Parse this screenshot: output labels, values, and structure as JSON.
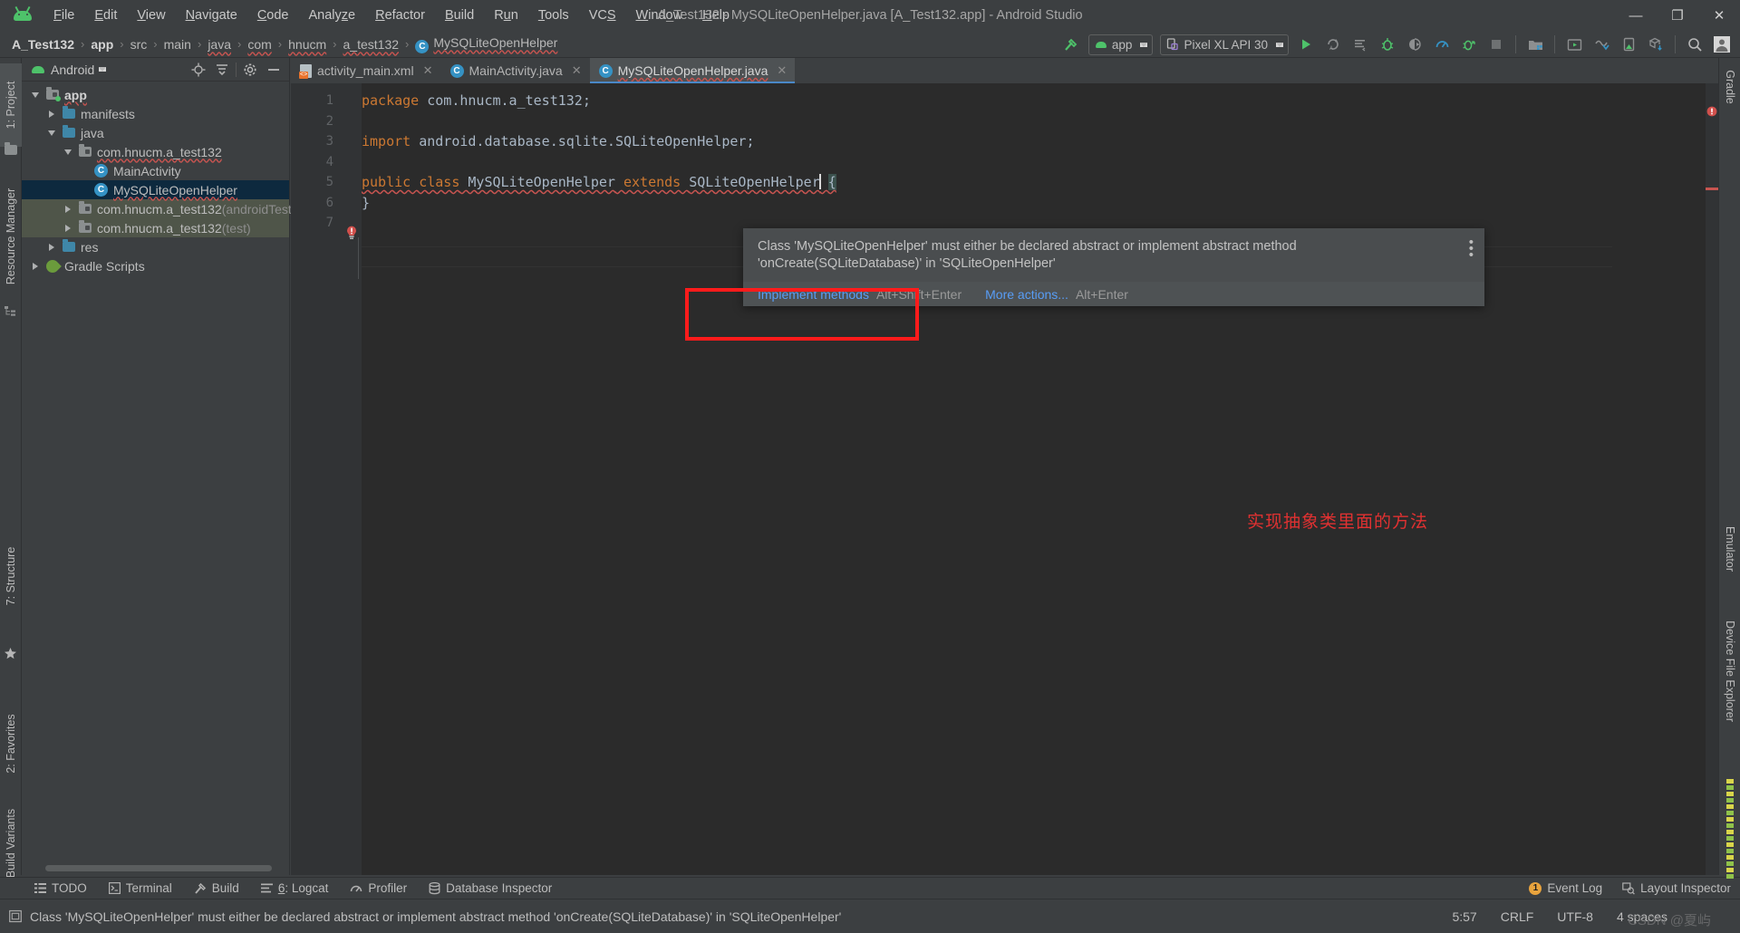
{
  "window": {
    "title": "A_Test132 - MySQLiteOpenHelper.java [A_Test132.app] - Android Studio",
    "minimize": "—",
    "maximize": "❐",
    "close": "✕"
  },
  "menubar": {
    "items": [
      {
        "label": "File",
        "mnemonic": "F"
      },
      {
        "label": "Edit",
        "mnemonic": "E"
      },
      {
        "label": "View",
        "mnemonic": "V"
      },
      {
        "label": "Navigate",
        "mnemonic": "N"
      },
      {
        "label": "Code",
        "mnemonic": "C"
      },
      {
        "label": "Analyze",
        "mnemonic": "z"
      },
      {
        "label": "Refactor",
        "mnemonic": "R"
      },
      {
        "label": "Build",
        "mnemonic": "B"
      },
      {
        "label": "Run",
        "mnemonic": "u"
      },
      {
        "label": "Tools",
        "mnemonic": "T"
      },
      {
        "label": "VCS",
        "mnemonic": "S"
      },
      {
        "label": "Window",
        "mnemonic": "W"
      },
      {
        "label": "Help",
        "mnemonic": "H"
      }
    ]
  },
  "breadcrumb": {
    "items": [
      {
        "label": "A_Test132",
        "bold": true
      },
      {
        "label": "app",
        "bold": true
      },
      {
        "label": "src",
        "bold": false
      },
      {
        "label": "main",
        "bold": false
      },
      {
        "label": "java",
        "bold": false
      },
      {
        "label": "com",
        "bold": false
      },
      {
        "label": "hnucm",
        "bold": false
      },
      {
        "label": "a_test132",
        "bold": false
      },
      {
        "label": "MySQLiteOpenHelper",
        "bold": false,
        "class_badge": "C"
      }
    ],
    "separator": "›"
  },
  "toolbar": {
    "module_selector": "app",
    "device_selector": "Pixel XL API 30",
    "icons": [
      "hammer-build-icon",
      "run-icon",
      "apply-changes-icon",
      "apply-code-changes-icon",
      "debug-icon",
      "attach-debugger-icon",
      "profiler-icon",
      "run-with-coverage-icon",
      "stop-icon",
      "sdk-manager-icon",
      "avd-manager-icon",
      "layout-inspector-icon",
      "device-file-explorer-icon",
      "build-variants-icon",
      "search-icon",
      "avatar-icon"
    ]
  },
  "left_tool_strip": {
    "tabs": [
      {
        "label": "1: Project",
        "selected": true
      },
      {
        "label": "Resource Manager",
        "selected": false
      },
      {
        "label": "7: Structure",
        "selected": false
      },
      {
        "label": "2: Favorites",
        "selected": false
      },
      {
        "label": "Build Variants",
        "selected": false
      }
    ]
  },
  "right_tool_strip": {
    "tabs": [
      {
        "label": "Gradle"
      },
      {
        "label": "Emulator"
      },
      {
        "label": "Device File Explorer"
      }
    ]
  },
  "project_panel": {
    "title": "Android",
    "header_icons": [
      "target-locate-icon",
      "collapse-all-icon",
      "settings-gear-icon",
      "hide-panel-icon"
    ],
    "tree": [
      {
        "indent": 0,
        "twisty": "down",
        "icon": "module-folder",
        "label": "app",
        "bold": true,
        "squiggle": true
      },
      {
        "indent": 1,
        "twisty": "right",
        "icon": "folder-blue",
        "label": "manifests",
        "bold": false
      },
      {
        "indent": 1,
        "twisty": "down",
        "icon": "folder-blue",
        "label": "java",
        "bold": false
      },
      {
        "indent": 2,
        "twisty": "down",
        "icon": "package",
        "label": "com.hnucm.a_test132",
        "bold": false,
        "squiggle": true
      },
      {
        "indent": 3,
        "twisty": "none",
        "icon": "class",
        "label": "MainActivity",
        "bold": false
      },
      {
        "indent": 3,
        "twisty": "none",
        "icon": "class",
        "label": "MySQLiteOpenHelper",
        "bold": false,
        "selected": true,
        "squiggle": true
      },
      {
        "indent": 2,
        "twisty": "right",
        "icon": "package",
        "label": "com.hnucm.a_test132",
        "suffix": " (androidTest)",
        "testbg": true
      },
      {
        "indent": 2,
        "twisty": "right",
        "icon": "package",
        "label": "com.hnucm.a_test132",
        "suffix": " (test)",
        "testbg": true
      },
      {
        "indent": 1,
        "twisty": "right",
        "icon": "folder-blue",
        "label": "res",
        "bold": false
      },
      {
        "indent": 0,
        "twisty": "right",
        "icon": "gradle",
        "label": "Gradle Scripts",
        "bold": false
      }
    ]
  },
  "editor": {
    "tabs": [
      {
        "label": "activity_main.xml",
        "icon": "xml-layout-icon",
        "active": false
      },
      {
        "label": "MainActivity.java",
        "icon": "class-icon",
        "active": false
      },
      {
        "label": "MySQLiteOpenHelper.java",
        "icon": "class-icon",
        "active": true,
        "squiggle": true
      }
    ],
    "line_numbers": [
      "1",
      "2",
      "3",
      "4",
      "5",
      "6",
      "7"
    ],
    "code": [
      {
        "n": 1,
        "segments": [
          {
            "t": "package",
            "c": "kw"
          },
          {
            "t": " com.hnucm.a_test132;",
            "c": "plain"
          }
        ]
      },
      {
        "n": 2,
        "segments": []
      },
      {
        "n": 3,
        "segments": [
          {
            "t": "import",
            "c": "kw"
          },
          {
            "t": " android.database.sqlite.SQLiteOpenHelper;",
            "c": "plain"
          }
        ]
      },
      {
        "n": 4,
        "segments": []
      },
      {
        "n": 5,
        "segments": [
          {
            "t": "public",
            "c": "kw"
          },
          {
            "t": " ",
            "c": "plain"
          },
          {
            "t": "class",
            "c": "kw"
          },
          {
            "t": " ",
            "c": "plain"
          },
          {
            "t": "MySQLiteOpenHelper",
            "c": "clsgray"
          },
          {
            "t": " ",
            "c": "plain"
          },
          {
            "t": "extends",
            "c": "kw"
          },
          {
            "t": " ",
            "c": "plain"
          },
          {
            "t": "SQLiteOpenHelper",
            "c": "plain"
          },
          {
            "t": "▏",
            "c": "caret"
          },
          {
            "t": " ",
            "c": "plain"
          },
          {
            "t": "{",
            "c": "brace"
          }
        ]
      },
      {
        "n": 6,
        "segments": [
          {
            "t": "}",
            "c": "plain"
          }
        ]
      },
      {
        "n": 7,
        "segments": []
      }
    ],
    "gutter_icon": "error-bulb-icon"
  },
  "popup": {
    "message_line1": "Class 'MySQLiteOpenHelper' must either be declared abstract or implement abstract method",
    "message_line2": "'onCreate(SQLiteDatabase)' in 'SQLiteOpenHelper'",
    "more_menu": "⋮",
    "actions": [
      {
        "label": "Implement methods",
        "shortcut": "Alt+Shift+Enter"
      },
      {
        "label": "More actions...",
        "shortcut": "Alt+Enter"
      }
    ],
    "highlight_color": "#ff1b1b"
  },
  "annotation": {
    "text": "实现抽象类里面的方法",
    "color": "#e03131"
  },
  "tool_window_bar": {
    "left": [
      {
        "label": "TODO",
        "icon": "todo-icon"
      },
      {
        "label": "Terminal",
        "icon": "terminal-icon"
      },
      {
        "label": "Build",
        "icon": "build-hammer-icon"
      },
      {
        "label": "6: Logcat",
        "icon": "logcat-icon",
        "mnemonic": "6"
      },
      {
        "label": "Profiler",
        "icon": "profiler-icon"
      },
      {
        "label": "Database Inspector",
        "icon": "database-icon"
      }
    ],
    "right": [
      {
        "label": "Event Log",
        "icon": "event-log-icon",
        "badge": "1"
      },
      {
        "label": "Layout Inspector",
        "icon": "layout-inspector-icon"
      }
    ]
  },
  "status_bar": {
    "message": "Class 'MySQLiteOpenHelper' must either be declared abstract or implement abstract method 'onCreate(SQLiteDatabase)' in 'SQLiteOpenHelper'",
    "message_icon": "inspection-icon",
    "caret_position": "5:57",
    "line_separator": "CRLF",
    "encoding": "UTF-8",
    "indent": "4 spaces",
    "watermark": "CSDN @夏屿"
  },
  "colors": {
    "chrome_bg": "#3c3f41",
    "editor_bg": "#2b2b2b",
    "gutter_bg": "#313335",
    "keyword": "#cc7832",
    "text": "#a9b7c6",
    "error": "#c75450",
    "accent_blue": "#589df6",
    "selection": "#0d293e",
    "android_green": "#4ec26a",
    "test_bg": "#4f5549"
  }
}
